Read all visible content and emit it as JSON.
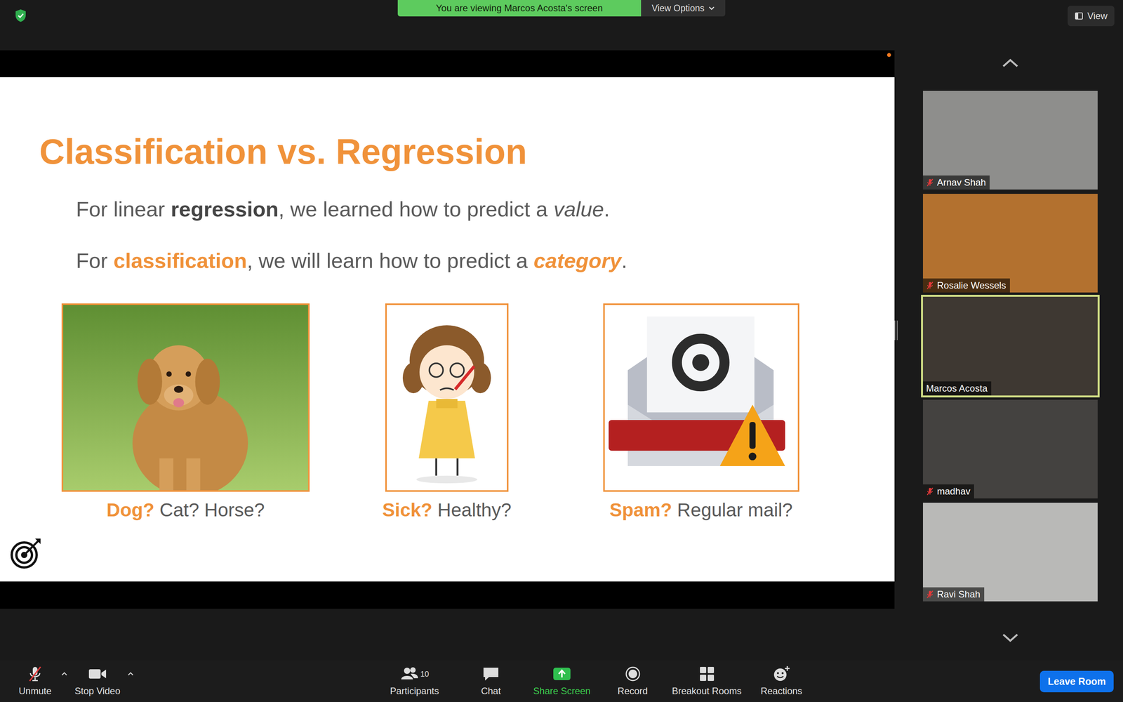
{
  "top_bar": {
    "banner": "You are viewing Marcos Acosta's screen",
    "view_options": "View Options",
    "view_button": "View"
  },
  "slide": {
    "title": "Classification vs. Regression",
    "lines": [
      [
        {
          "text": "For linear ",
          "kind": "plain"
        },
        {
          "text": "regression",
          "kind": "bold"
        },
        {
          "text": ", we learned how to predict a ",
          "kind": "plain"
        },
        {
          "text": "value",
          "kind": "italic"
        },
        {
          "text": ".",
          "kind": "plain"
        }
      ],
      [
        {
          "text": "For ",
          "kind": "plain"
        },
        {
          "text": "classification",
          "kind": "accent"
        },
        {
          "text": ", we will learn how to predict a ",
          "kind": "plain"
        },
        {
          "text": "category",
          "kind": "accent-italic"
        },
        {
          "text": ".",
          "kind": "plain"
        }
      ]
    ],
    "cards": [
      {
        "kind": "dog",
        "caption": [
          {
            "text": "Dog?",
            "kind": "accent"
          },
          {
            "text": " Cat? Horse?",
            "kind": "plain"
          }
        ]
      },
      {
        "kind": "girl",
        "caption": [
          {
            "text": "Sick?",
            "kind": "accent"
          },
          {
            "text": " Healthy?",
            "kind": "plain"
          }
        ]
      },
      {
        "kind": "spam",
        "caption": [
          {
            "text": "Spam?",
            "kind": "accent"
          },
          {
            "text": " Regular mail?",
            "kind": "plain"
          }
        ]
      }
    ]
  },
  "participants": [
    {
      "name": "Arnav Shah",
      "muted": true,
      "speaking": false,
      "color": "#8e8e8c"
    },
    {
      "name": "Rosalie Wessels",
      "muted": true,
      "speaking": false,
      "color": "#b3712f"
    },
    {
      "name": "Marcos Acosta",
      "muted": false,
      "speaking": true,
      "color": "#3e3832"
    },
    {
      "name": "madhav",
      "muted": true,
      "speaking": false,
      "color": "#444240"
    },
    {
      "name": "Ravi Shah",
      "muted": true,
      "speaking": false,
      "color": "#b9b9b7"
    }
  ],
  "toolbar": {
    "left": [
      {
        "label": "Unmute",
        "kind": "mic-off",
        "menu": true
      },
      {
        "label": "Stop Video",
        "kind": "video",
        "menu": true
      }
    ],
    "center": [
      {
        "label": "Participants",
        "kind": "participants",
        "count": "10"
      },
      {
        "label": "Chat",
        "kind": "chat"
      },
      {
        "label": "Share Screen",
        "kind": "share"
      },
      {
        "label": "Record",
        "kind": "record"
      },
      {
        "label": "Breakout Rooms",
        "kind": "breakout"
      },
      {
        "label": "Reactions",
        "kind": "reactions"
      }
    ],
    "leave": "Leave Room"
  }
}
